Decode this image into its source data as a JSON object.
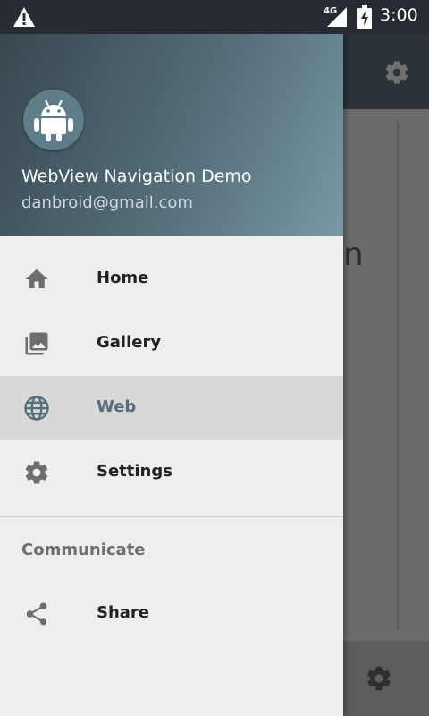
{
  "status_bar": {
    "network": "4G",
    "time": "3:00",
    "icons": [
      "warning-icon",
      "signal-icon",
      "battery-charging-icon"
    ]
  },
  "drawer": {
    "header": {
      "avatar_icon": "android-icon",
      "app_name": "WebView Navigation Demo",
      "email": "danbroid@gmail.com"
    },
    "items": [
      {
        "label": "Home",
        "icon": "home-icon"
      },
      {
        "label": "Gallery",
        "icon": "gallery-icon"
      },
      {
        "label": "Web",
        "icon": "globe-icon",
        "selected": true
      },
      {
        "label": "Settings",
        "icon": "gear-icon"
      }
    ],
    "section_title": "Communicate",
    "section_items": [
      {
        "label": "Share",
        "icon": "share-icon"
      }
    ]
  },
  "background": {
    "partial_text": "n"
  },
  "colors": {
    "accent": "#546e7a",
    "header_start": "#37474f",
    "header_end": "#7b98a5",
    "selected_bg": "#d8d8d8"
  }
}
